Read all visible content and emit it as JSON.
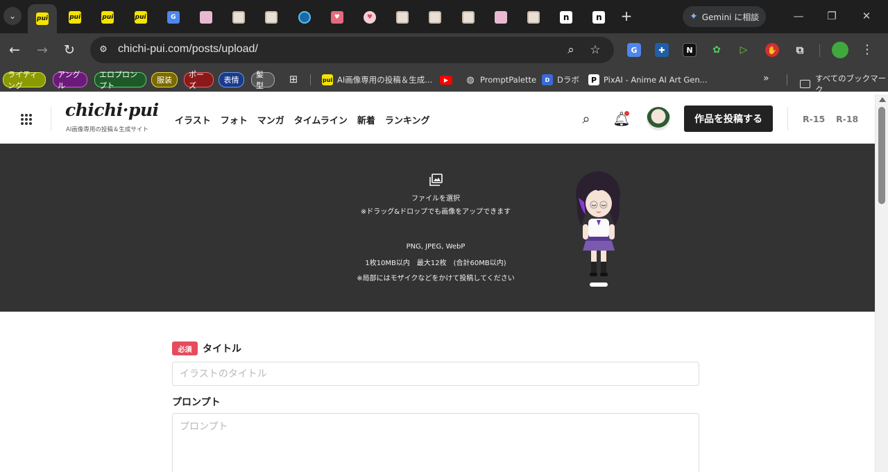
{
  "browser": {
    "tabs": [
      {
        "icon": "pui-favicon",
        "text": "pui",
        "active": true
      },
      {
        "icon": "pui-favicon",
        "text": "pui"
      },
      {
        "icon": "pui-favicon",
        "text": "pui"
      },
      {
        "icon": "pui-favicon",
        "text": "pui"
      },
      {
        "icon": "google-translate-favicon",
        "text": "G"
      },
      {
        "icon": "pink-favicon",
        "text": ""
      },
      {
        "icon": "doc-favicon",
        "text": ""
      },
      {
        "icon": "doc-favicon",
        "text": ""
      },
      {
        "icon": "circle-favicon",
        "text": ""
      },
      {
        "icon": "heart-favicon",
        "text": "♥"
      },
      {
        "icon": "heart-circle-favicon",
        "text": "♥"
      },
      {
        "icon": "doc-favicon",
        "text": ""
      },
      {
        "icon": "doc-favicon",
        "text": ""
      },
      {
        "icon": "doc-favicon",
        "text": ""
      },
      {
        "icon": "pink-favicon",
        "text": ""
      },
      {
        "icon": "doc-favicon",
        "text": ""
      },
      {
        "icon": "n-favicon",
        "text": "n"
      },
      {
        "icon": "n-favicon",
        "text": "n"
      }
    ],
    "gemini_label": "Gemini に相談",
    "url": "chichi-pui.com/posts/upload/"
  },
  "bookmarks": {
    "tags": [
      {
        "label": "ライティング",
        "color": "#8a9a00",
        "border": "#d8e84a"
      },
      {
        "label": "アングル",
        "color": "#6a1b7a",
        "border": "#d35bd8"
      },
      {
        "label": "エロプロンプト",
        "color": "#1e5a28",
        "border": "#5fd070"
      },
      {
        "label": "服装",
        "color": "#7a6a00",
        "border": "#e8d84a"
      },
      {
        "label": "ポーズ",
        "color": "#8a1a1a",
        "border": "#f06060"
      },
      {
        "label": "表情",
        "color": "#1a3a8a",
        "border": "#6a9af0"
      },
      {
        "label": "髪型",
        "color": "#555555",
        "border": "#aaaaaa"
      }
    ],
    "links": [
      {
        "icon": "pui-favicon",
        "label": "AI画像専用の投稿＆生成..."
      },
      {
        "icon": "youtube-favicon",
        "label": ""
      },
      {
        "icon": "globe-favicon",
        "label": "PromptPalette"
      },
      {
        "icon": "dlabo-favicon",
        "label": "Dラボ"
      },
      {
        "icon": "pixai-favicon",
        "label": "PixAI - Anime AI Art Gen..."
      }
    ],
    "more": "»",
    "folder_label": "すべてのブックマーク"
  },
  "site": {
    "logo": "chichi·pui",
    "logo_sub": "AI画像専用の投稿＆生成サイト",
    "nav": [
      "イラスト",
      "フォト",
      "マンガ",
      "タイムライン",
      "新着",
      "ランキング"
    ],
    "post_button": "作品を投稿する",
    "ratings": [
      "R-15",
      "R-18"
    ]
  },
  "upload": {
    "select_label": "ファイルを選択",
    "drag_hint": "※ドラッグ&ドロップでも画像をアップできます",
    "formats": "PNG, JPEG, WebP",
    "limits": "1枚10MB以内　最大12枚　(合計60MB以内)",
    "mosaic_note": "※局部にはモザイクなどをかけて投稿してください"
  },
  "form": {
    "required_badge": "必須",
    "title_label": "タイトル",
    "title_placeholder": "イラストのタイトル",
    "prompt_label": "プロンプト",
    "prompt_placeholder": "プロンプト"
  }
}
